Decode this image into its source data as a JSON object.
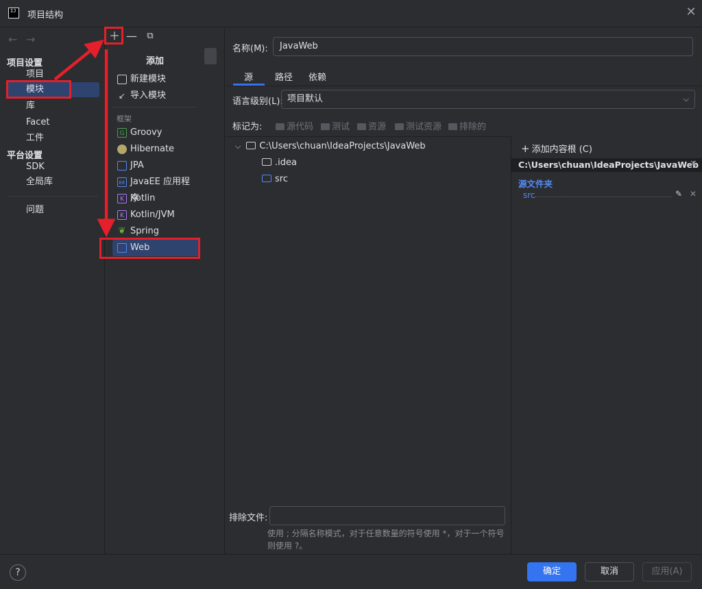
{
  "window": {
    "title": "项目结构",
    "app_icon_text": "IJ"
  },
  "sidebar": {
    "project_settings_header": "项目设置",
    "project_settings_items": [
      {
        "label": "项目"
      },
      {
        "label": "模块"
      },
      {
        "label": "库"
      },
      {
        "label": "Facet"
      },
      {
        "label": "工件"
      }
    ],
    "platform_settings_header": "平台设置",
    "platform_settings_items": [
      {
        "label": "SDK"
      },
      {
        "label": "全局库"
      }
    ],
    "problems_label": "问题",
    "back_icon": "arrow-left-icon",
    "forward_icon": "arrow-right-icon"
  },
  "toolbar": {
    "add_icon": "plus-icon",
    "remove_icon": "minus-icon",
    "copy_icon": "copy-icon"
  },
  "add_popup": {
    "title": "添加",
    "items": [
      {
        "label": "新建模块",
        "icon": "new-module-icon"
      },
      {
        "label": "导入模块",
        "icon": "import-module-icon"
      }
    ],
    "framework_header": "框架",
    "frameworks": [
      {
        "label": "Groovy",
        "icon": "groovy-icon",
        "color": "#4aa14f"
      },
      {
        "label": "Hibernate",
        "icon": "hibernate-icon",
        "color": "#b5a66a"
      },
      {
        "label": "JPA",
        "icon": "jpa-icon",
        "color": "#548af7"
      },
      {
        "label": "JavaEE 应用程序",
        "icon": "javaee-icon",
        "color": "#548af7"
      },
      {
        "label": "Kotlin",
        "icon": "kotlin-icon",
        "color": "#a97bff"
      },
      {
        "label": "Kotlin/JVM",
        "icon": "kotlin-jvm-icon",
        "color": "#a97bff"
      },
      {
        "label": "Spring",
        "icon": "spring-icon",
        "color": "#5fb832"
      },
      {
        "label": "Web",
        "icon": "web-icon",
        "color": "#548af7"
      }
    ]
  },
  "module": {
    "name_label": "名称(M):",
    "name_value": "JavaWeb",
    "tabs": [
      {
        "label": "源"
      },
      {
        "label": "路径"
      },
      {
        "label": "依赖"
      }
    ],
    "language_level_label": "语言级别(L):",
    "language_level_value": "项目默认",
    "mark_as_label": "标记为:",
    "mark_as_buttons": [
      {
        "label": "源代码"
      },
      {
        "label": "测试"
      },
      {
        "label": "资源"
      },
      {
        "label": "测试资源"
      },
      {
        "label": "排除的"
      }
    ]
  },
  "tree": {
    "root": "C:\\Users\\chuan\\IdeaProjects\\JavaWeb",
    "children": [
      {
        "label": ".idea"
      },
      {
        "label": "src"
      }
    ]
  },
  "content_root": {
    "add_label": "添加内容根 (C)",
    "path": "C:\\Users\\chuan\\IdeaProjects\\JavaWeb",
    "source_folders_label": "源文件夹",
    "source_entry": "src"
  },
  "exclude": {
    "label": "排除文件:",
    "value": "",
    "hint": "使用 ; 分隔名称模式，对于任意数量的符号使用 *，对于一个符号则使用 ?。"
  },
  "footer": {
    "help_label": "?",
    "ok_label": "确定",
    "cancel_label": "取消",
    "apply_label": "应用(A)"
  },
  "colors": {
    "accent": "#3574f0",
    "annotation": "#e5202a",
    "selection": "#2e436e"
  }
}
